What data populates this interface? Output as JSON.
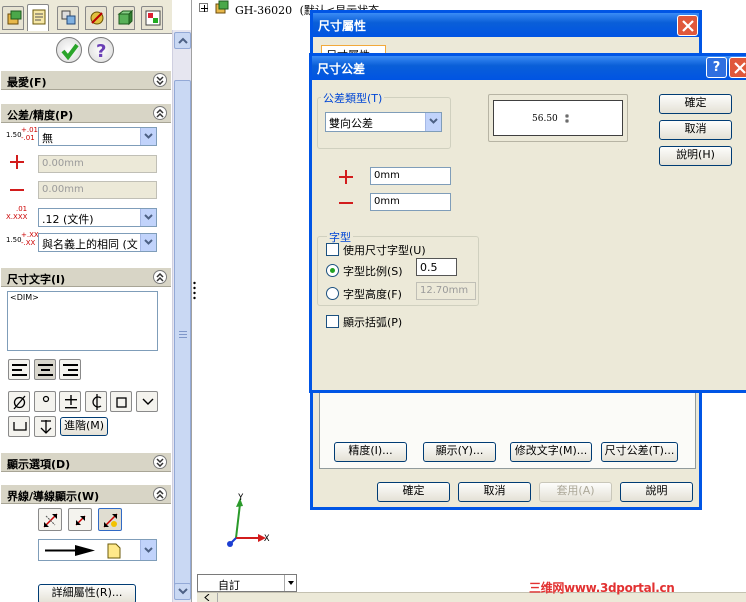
{
  "tree": {
    "item": "GH-36020",
    "suffix": "(默认<显示状态"
  },
  "pm": {
    "tabs": [
      "feature-manager",
      "property-manager",
      "configuration-manager",
      "dimxpert-manager",
      "display-manager",
      "appearance-manager"
    ],
    "sections": {
      "favorites": "最愛(F)",
      "tolerance": "公差/精度(P)",
      "dimtext": "尺寸文字(I)",
      "display": "顯示選項(D)",
      "leaders": "界線/導線顯示(W)"
    },
    "tolerance": {
      "type_value": "無",
      "plus_value": "0.00mm",
      "minus_value": "0.00mm",
      "precision_value": ".12 (文件)",
      "tol_precision_value": "與名義上的相同 (文",
      "icon_tol_base": "1.50",
      "icon_tol_plus": "+.01",
      "icon_tol_minus": "-.01",
      "icon_prec_top": ".01",
      "icon_prec_base": "X.XXX",
      "icon_tp_plus": "+.XX",
      "icon_tp_minus": "-.XX"
    },
    "dimtext": {
      "content": "<DIM>",
      "advanced": "進階(M)"
    },
    "details_button": "詳細屬性(R)..."
  },
  "viewport": {
    "triad_y": "Y",
    "triad_x": "X",
    "tab_label": "自訂"
  },
  "dim_props": {
    "title": "尺寸屬性",
    "tab": "尺寸屬性",
    "buttons": {
      "precision": "精度(I)...",
      "display": "顯示(Y)...",
      "modify_text": "修改文字(M)...",
      "tolerance": "尺寸公差(T)..."
    },
    "footer": {
      "ok": "確定",
      "cancel": "取消",
      "apply": "套用(A)",
      "help": "說明"
    }
  },
  "tol_dialog": {
    "title": "尺寸公差",
    "type_group": "公差類型(T)",
    "type_value": "雙向公差",
    "preview_value": "56.50",
    "plus_value": "0mm",
    "minus_value": "0mm",
    "font_group": "字型",
    "use_dim_font": "使用尺寸字型(U)",
    "font_scale": "字型比例(S)",
    "font_scale_value": "0.5",
    "font_height": "字型高度(F)",
    "font_height_value": "12.70mm",
    "show_parens": "顯示括弧(P)",
    "buttons": {
      "ok": "確定",
      "cancel": "取消",
      "help": "說明(H)"
    }
  },
  "watermark": "三维网www.3dportal.cn",
  "colors": {
    "titlebar": "#0054e3",
    "accent_red": "#d21c1c",
    "check_green": "#2aa52a",
    "help_purple": "#6a3fb5"
  }
}
